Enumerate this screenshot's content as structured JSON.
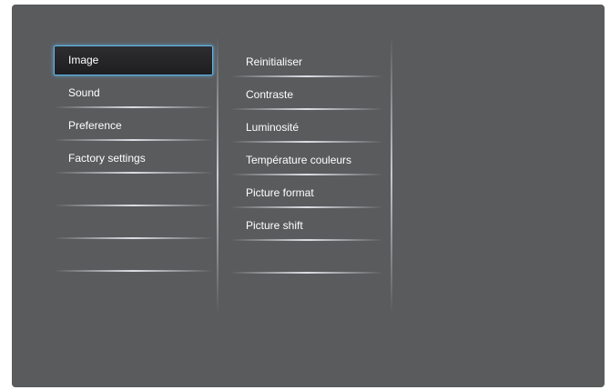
{
  "menu": {
    "left": {
      "items": [
        {
          "label": "Image",
          "selected": true
        },
        {
          "label": "Sound"
        },
        {
          "label": "Preference"
        },
        {
          "label": "Factory settings"
        },
        {
          "label": ""
        },
        {
          "label": ""
        },
        {
          "label": ""
        }
      ]
    },
    "middle": {
      "items": [
        {
          "label": "Reinitialiser"
        },
        {
          "label": "Contraste"
        },
        {
          "label": "Luminosité"
        },
        {
          "label": "Température couleurs"
        },
        {
          "label": "Picture format"
        },
        {
          "label": "Picture shift"
        },
        {
          "label": ""
        }
      ]
    }
  },
  "colors": {
    "panel_bg": "#5a5b5d",
    "selection_border": "#5fb6e8",
    "selection_bg": "#1e1d1f",
    "text": "#ffffff"
  }
}
